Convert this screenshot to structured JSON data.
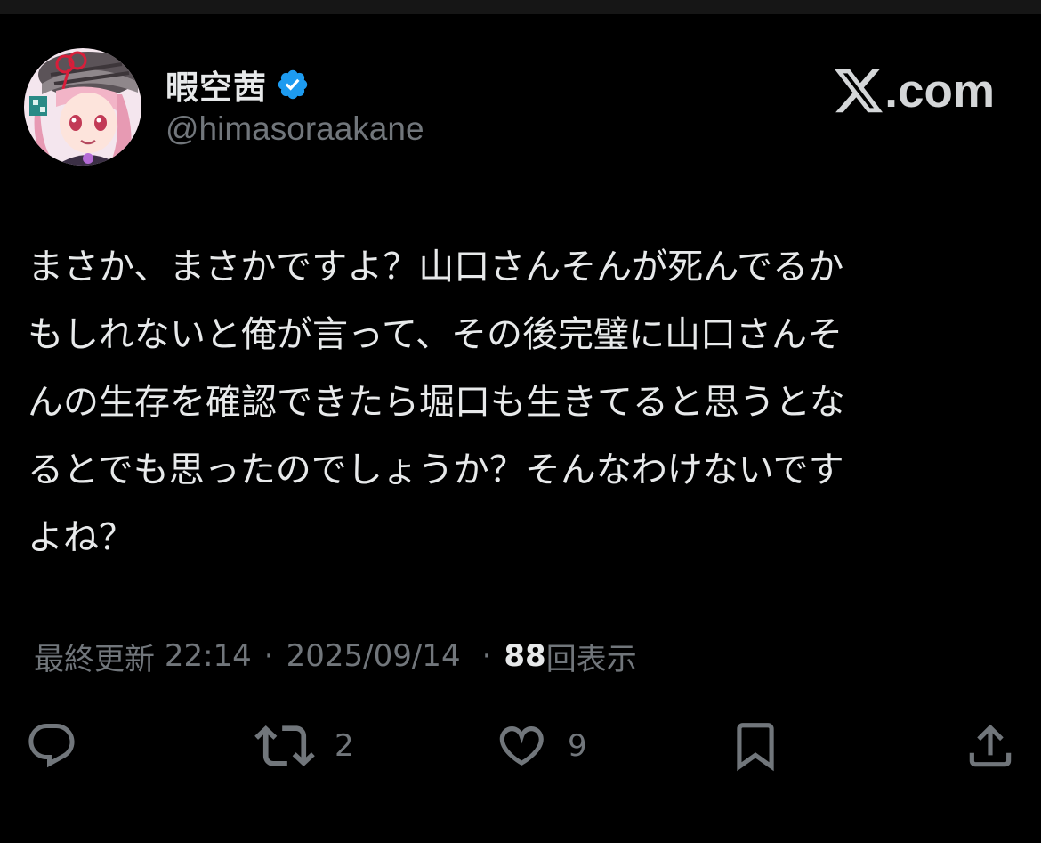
{
  "post": {
    "author": {
      "display_name": "暇空茜",
      "handle": "@himasoraakane",
      "verified": true
    },
    "brand": {
      "logo_text": ".com"
    },
    "text": "まさか、まさかですよ？山口さんそんが死んでるか\nもしれないと俺が言って、その後完璧に山口さんそ\nんの生存を確認できたら堀口も生きてると思うとな\nるとでも思ったのでしょうか？そんなわけないです\nよね？",
    "meta": {
      "edited_label": "最終更新",
      "time": "22:14",
      "separator": "·",
      "date": "2025/09/14",
      "views_count": "88",
      "views_label": "回表示"
    },
    "actions": {
      "reply_count": "",
      "repost_count": "2",
      "like_count": "9"
    }
  },
  "colors": {
    "background": "#000000",
    "text_primary": "#e7e9ea",
    "text_secondary": "#71767b",
    "verified_blue": "#1d9bf0"
  },
  "icons": [
    "verified-badge-icon",
    "x-logo-icon",
    "reply-icon",
    "repost-icon",
    "like-icon",
    "bookmark-icon",
    "share-icon"
  ]
}
